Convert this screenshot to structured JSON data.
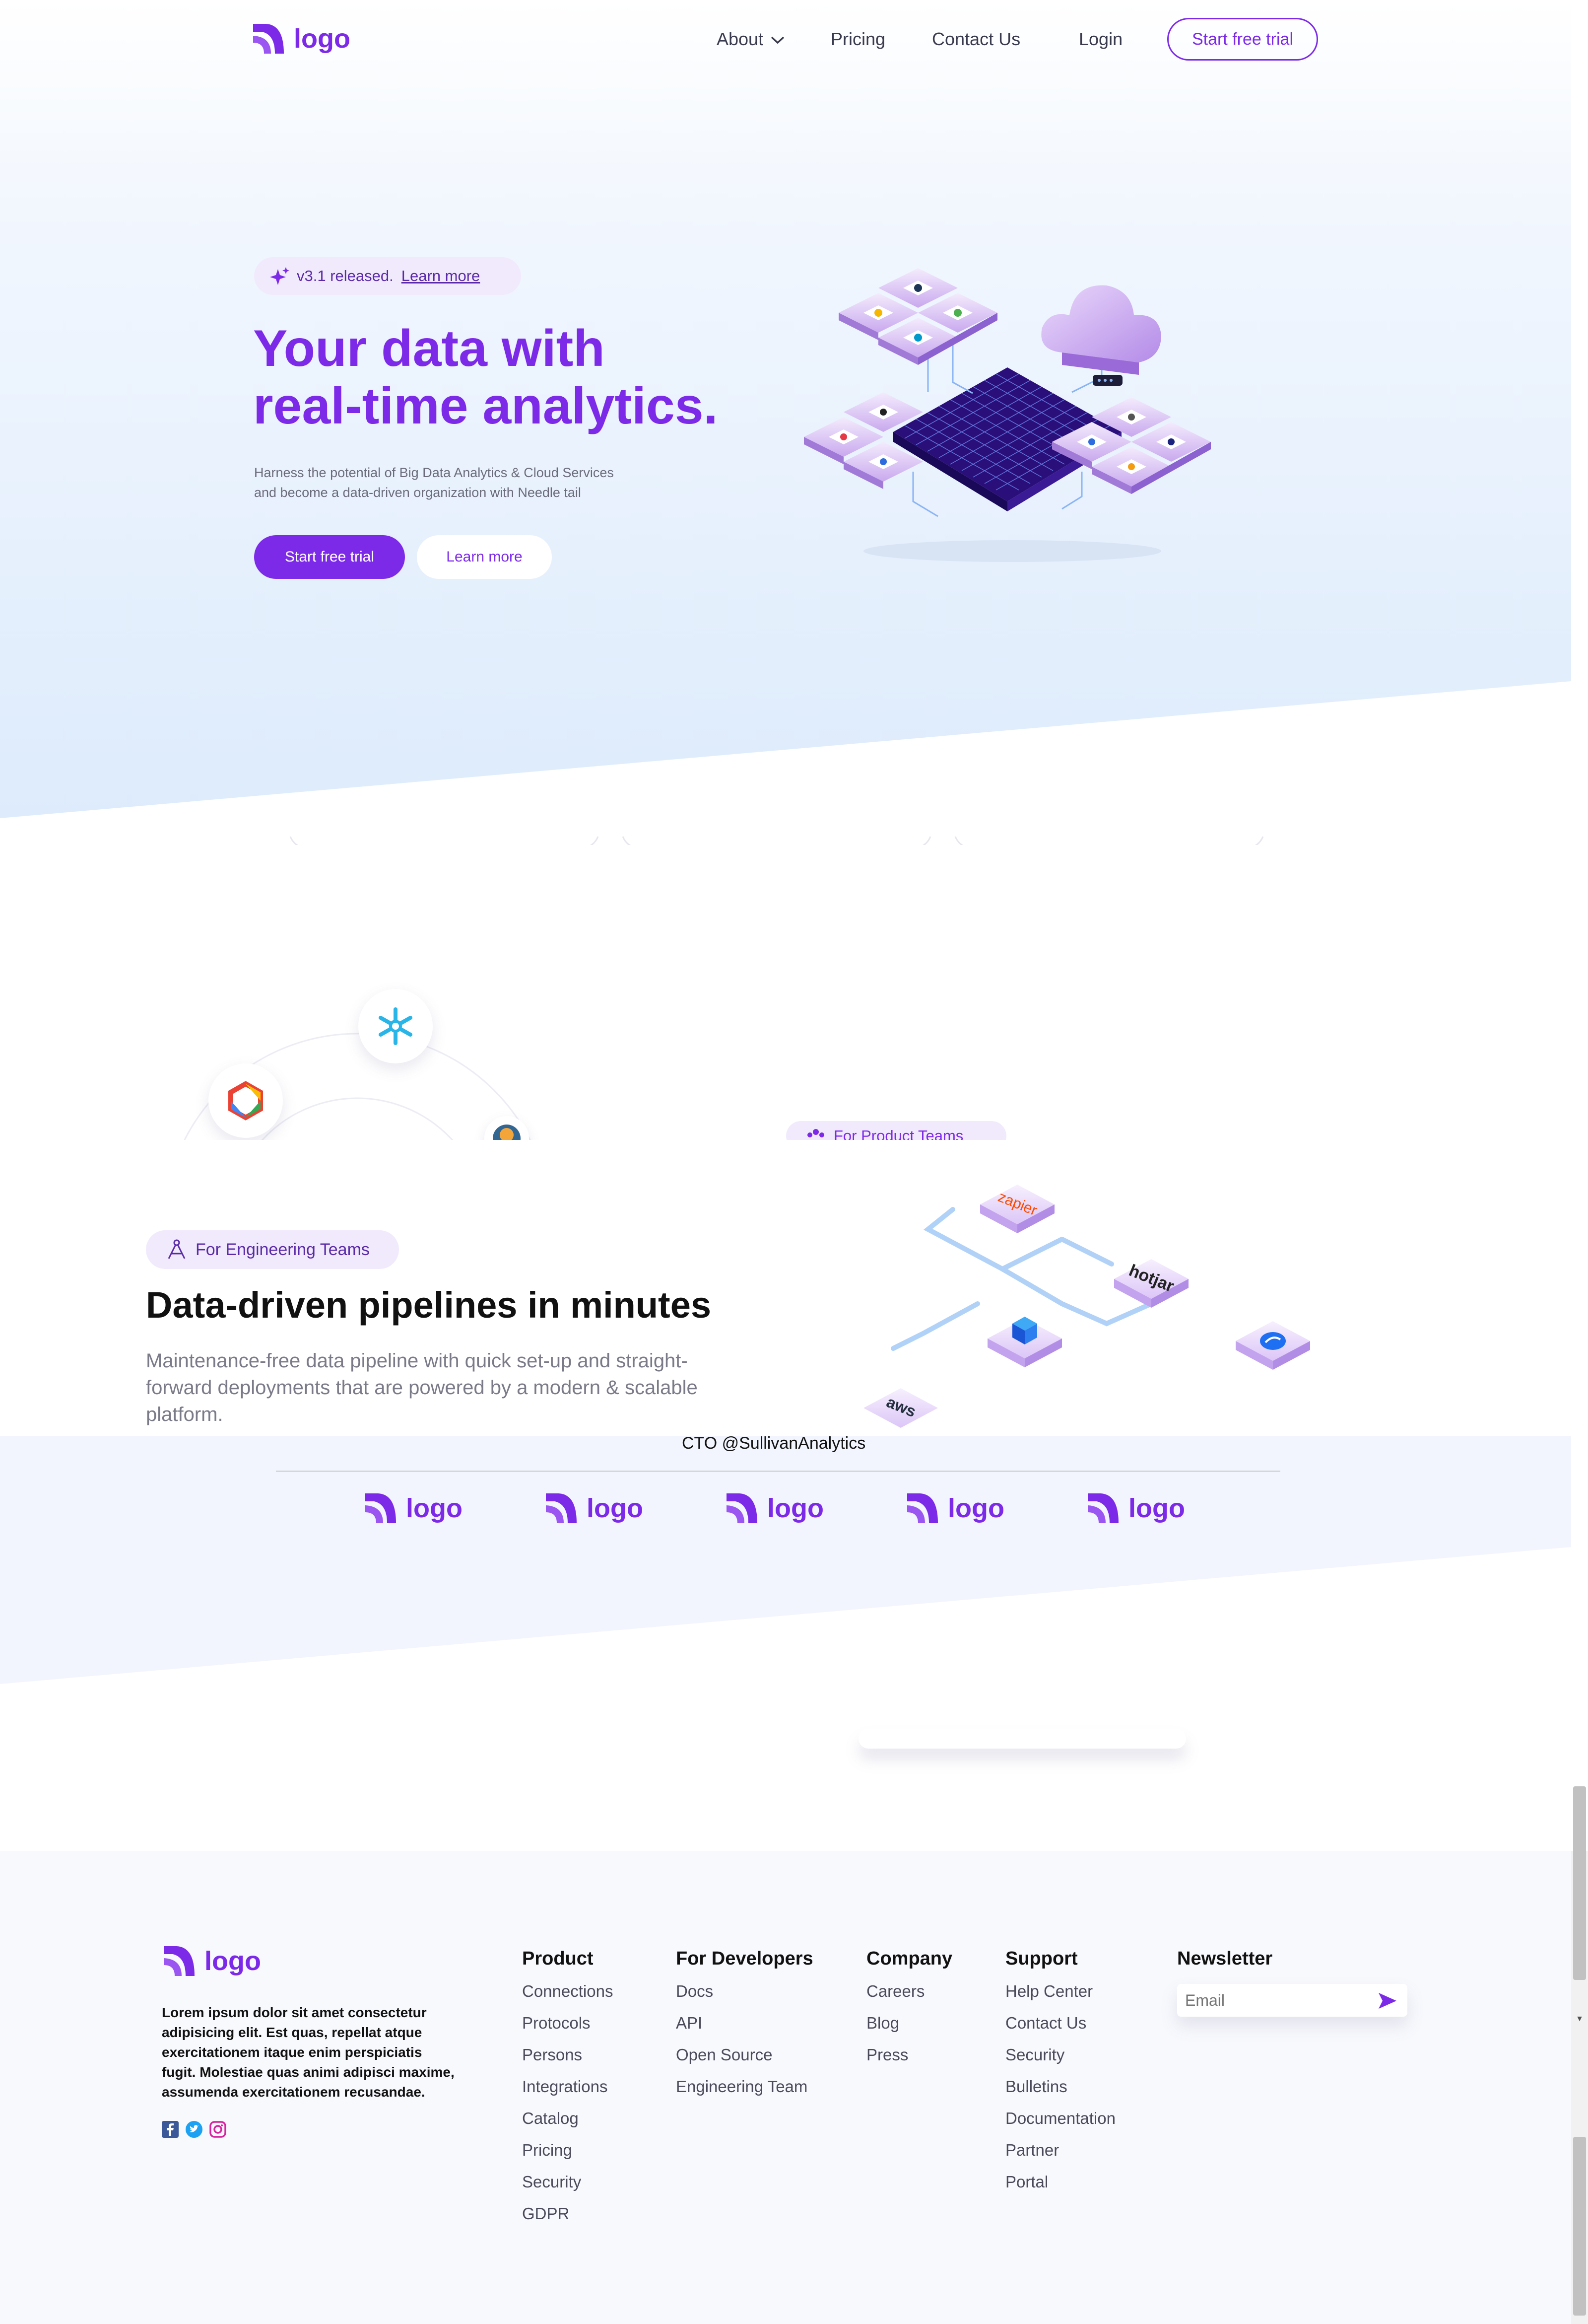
{
  "nav": {
    "logo": "logo",
    "about": "About",
    "pricing": "Pricing",
    "contact": "Contact Us",
    "login": "Login",
    "cta": "Start free trial"
  },
  "hero": {
    "badge_text": "v3.1 released.",
    "badge_link": "Learn more",
    "title_line1": "Your data with",
    "title_line2": "real-time analytics.",
    "subtitle_line1": "Harness the potential of Big Data Analytics & Cloud Services",
    "subtitle_line2": "and become a data-driven organization with Needle tail",
    "primary_button": "Start free trial",
    "secondary_button": "Learn more"
  },
  "teams": {
    "product_badge": "For Product Teams",
    "engineering_badge": "For Engineering Teams",
    "engineering_title": "Data-driven pipelines in minutes",
    "engineering_desc_line1": "Maintenance-free data pipeline with quick set-up and straight-",
    "engineering_desc_line2": "forward deployments that are powered by a modern & scalable",
    "engineering_desc_line3": "platform.",
    "integrations": [
      "zapier",
      "hotjar",
      "aws"
    ]
  },
  "testimonial": {
    "author_role": "CTO @SullivanAnalytics"
  },
  "logos_strip": [
    "logo",
    "logo",
    "logo",
    "logo",
    "logo"
  ],
  "footer": {
    "logo": "logo",
    "about_text_lines": [
      "Lorem ipsum dolor sit amet consectetur",
      "adipisicing elit. Est quas, repellat atque",
      "exercitationem itaque enim perspiciatis",
      "fugit. Molestiae quas animi adipisci maxime,",
      "assumenda exercitationem recusandae."
    ],
    "social_icons": [
      "facebook-icon",
      "twitter-icon",
      "instagram-icon"
    ],
    "columns": [
      {
        "title": "Product",
        "links": [
          "Connections",
          "Protocols",
          "Persons",
          "Integrations",
          "Catalog",
          "Pricing",
          "Security",
          "GDPR"
        ]
      },
      {
        "title": "For Developers",
        "links": [
          "Docs",
          "API",
          "Open Source",
          "Engineering Team"
        ]
      },
      {
        "title": "Company",
        "links": [
          "Careers",
          "Blog",
          "Press"
        ]
      },
      {
        "title": "Support",
        "links": [
          "Help Center",
          "Contact Us",
          "Security",
          "Bulletins",
          "Documentation",
          "Partner",
          "Portal"
        ]
      }
    ],
    "newsletter": {
      "title": "Newsletter",
      "placeholder": "Email"
    }
  },
  "colors": {
    "brand": "#7d2ae8",
    "hero_bg": "#e3effd",
    "footer_bg": "#f8f9fd"
  }
}
